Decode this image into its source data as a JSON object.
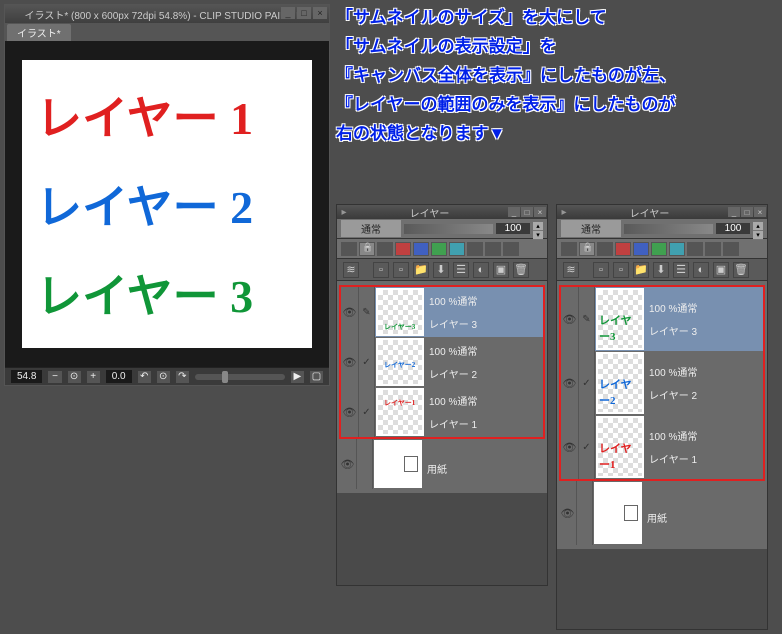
{
  "window": {
    "title": "イラスト* (800 x 600px 72dpi 54.8%)  - CLIP STUDIO PAINT EX",
    "tab": "イラスト*",
    "zoom": "54.8",
    "rotation": "0.0"
  },
  "canvas": {
    "line1": "レイヤー 1",
    "line2": "レイヤー 2",
    "line3": "レイヤー 3"
  },
  "annotation": {
    "l1": "「サムネイルのサイズ」を大にして",
    "l2": "「サムネイルの表示設定」を",
    "l3": "『キャンバス全体を表示』にしたものが左、",
    "l4": "『レイヤーの範囲のみを表示』にしたものが",
    "l5": "  右の状態となります▼"
  },
  "layerPanel": {
    "title": "レイヤー",
    "blendMode": "通常",
    "opacity": "100",
    "layers": [
      {
        "opacity": "100 %通常",
        "name": "レイヤー 3",
        "color": "#109638",
        "content": "レイヤー3"
      },
      {
        "opacity": "100 %通常",
        "name": "レイヤー 2",
        "color": "#1068d8",
        "content": "レイヤー2"
      },
      {
        "opacity": "100 %通常",
        "name": "レイヤー 1",
        "color": "#e02020",
        "content": "レイヤー1"
      }
    ],
    "paper": "用紙"
  }
}
